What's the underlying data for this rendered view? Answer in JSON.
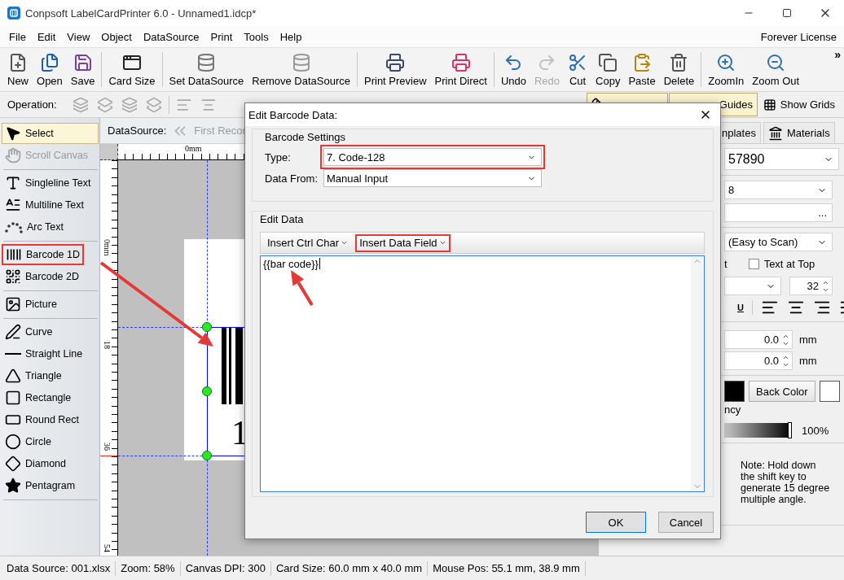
{
  "window": {
    "title": "Conpsoft LabelCardPrinter 6.0 - Unnamed1.idcp*"
  },
  "menu": {
    "items": [
      "File",
      "Edit",
      "View",
      "Object",
      "DataSource",
      "Print",
      "Tools",
      "Help"
    ],
    "license": "Forever License"
  },
  "toolbar": {
    "groups": [
      [
        {
          "label": "New",
          "disabled": false
        },
        {
          "label": "Open",
          "disabled": false
        },
        {
          "label": "Save",
          "disabled": false
        }
      ],
      [
        {
          "label": "Card Size",
          "disabled": false
        }
      ],
      [
        {
          "label": "Set DataSource",
          "disabled": false
        },
        {
          "label": "Remove DataSource",
          "disabled": false
        }
      ],
      [
        {
          "label": "Print Preview",
          "disabled": false
        },
        {
          "label": "Print Direct",
          "disabled": false
        }
      ],
      [
        {
          "label": "Undo",
          "disabled": false
        },
        {
          "label": "Redo",
          "disabled": true
        },
        {
          "label": "Cut",
          "disabled": false
        },
        {
          "label": "Copy",
          "disabled": false
        },
        {
          "label": "Paste",
          "disabled": false
        },
        {
          "label": "Delete",
          "disabled": false
        }
      ],
      [
        {
          "label": "ZoomIn",
          "disabled": false
        },
        {
          "label": "Zoom Out",
          "disabled": false
        }
      ]
    ],
    "overflow": "»"
  },
  "operation_bar": {
    "label": "Operation:",
    "toggles": [
      {
        "kind": "rulers",
        "selected": true
      },
      {
        "kind": "guides",
        "label": "Guides",
        "selected": true
      },
      {
        "kind": "grids",
        "label": "Show Grids",
        "selected": false
      }
    ]
  },
  "toolbox": {
    "groups": [
      [
        {
          "label": "Select",
          "selected": true,
          "disabled": false,
          "highlighted": false
        },
        {
          "label": "Scroll Canvas",
          "selected": false,
          "disabled": true,
          "highlighted": false
        }
      ],
      [
        {
          "label": "Singleline Text",
          "selected": false,
          "disabled": false,
          "highlighted": false
        },
        {
          "label": "Multiline Text",
          "selected": false,
          "disabled": false,
          "highlighted": false
        },
        {
          "label": "Arc Text",
          "selected": false,
          "disabled": false,
          "highlighted": false
        }
      ],
      [
        {
          "label": "Barcode 1D",
          "selected": false,
          "disabled": false,
          "highlighted": true
        },
        {
          "label": "Barcode 2D",
          "selected": false,
          "disabled": false,
          "highlighted": false
        }
      ],
      [
        {
          "label": "Picture",
          "selected": false,
          "disabled": false,
          "highlighted": false
        }
      ],
      [
        {
          "label": "Curve",
          "selected": false,
          "disabled": false,
          "highlighted": false
        },
        {
          "label": "Straight Line",
          "selected": false,
          "disabled": false,
          "highlighted": false
        },
        {
          "label": "Triangle",
          "selected": false,
          "disabled": false,
          "highlighted": false
        },
        {
          "label": "Rectangle",
          "selected": false,
          "disabled": false,
          "highlighted": false
        },
        {
          "label": "Round Rect",
          "selected": false,
          "disabled": false,
          "highlighted": false
        },
        {
          "label": "Circle",
          "selected": false,
          "disabled": false,
          "highlighted": false
        },
        {
          "label": "Diamond",
          "selected": false,
          "disabled": false,
          "highlighted": false
        },
        {
          "label": "Pentagram",
          "selected": false,
          "disabled": false,
          "highlighted": false
        }
      ]
    ]
  },
  "canvas": {
    "datasource_label": "DataSource:",
    "first_record": "First Recor",
    "top_ruler": [
      "0mm"
    ],
    "left_ruler": [
      "0mm",
      "18",
      "36",
      "54"
    ],
    "card_digit": "1"
  },
  "properties": {
    "tabs": [
      {
        "label": "nplates",
        "selected": false
      },
      {
        "label": "Materials",
        "selected": false
      }
    ],
    "data_combo": "57890",
    "type_combo": "8",
    "more_button": "...",
    "mode_combo": "(Easy to Scan)",
    "text_label": "t",
    "text_at_top": {
      "label": "Text at Top",
      "checked": false
    },
    "font_size": "32",
    "underline_button": "U",
    "offsets": [
      {
        "value": "0.0",
        "unit": "mm"
      },
      {
        "value": "0.0",
        "unit": "mm"
      }
    ],
    "fore_swatch": {
      "color": "#000000"
    },
    "back_color_button": "Back Color",
    "back_swatch": {
      "color": "#ffffff"
    },
    "transparency_label": "ncy",
    "transparency": {
      "level": 1,
      "reading": "100%"
    },
    "note": "Note: Hold down the shift key to generate 15 degree multiple angle."
  },
  "dialog": {
    "title": "Edit Barcode Data:",
    "settings": {
      "title": "Barcode Settings",
      "type": {
        "label": "Type:",
        "value": "7.  Code-128",
        "highlighted": true
      },
      "data_from": {
        "label": "Data From:",
        "value": "Manual Input",
        "highlighted": false
      }
    },
    "edit": {
      "title": "Edit Data",
      "buttons": [
        {
          "label": "Insert Ctrl Char",
          "highlighted": false
        },
        {
          "label": "Insert Data Field",
          "highlighted": true
        }
      ],
      "text": "{{bar code}}"
    },
    "buttons": [
      {
        "label": "OK",
        "default": true
      },
      {
        "label": "Cancel",
        "default": false
      }
    ]
  },
  "status_bar": [
    "Data Source: 001.xlsx",
    "Zoom: 58%",
    "Canvas DPI: 300",
    "Card Size: 60.0 mm x 40.0 mm",
    "Mouse Pos: 55.1 mm, 38.9 mm"
  ]
}
